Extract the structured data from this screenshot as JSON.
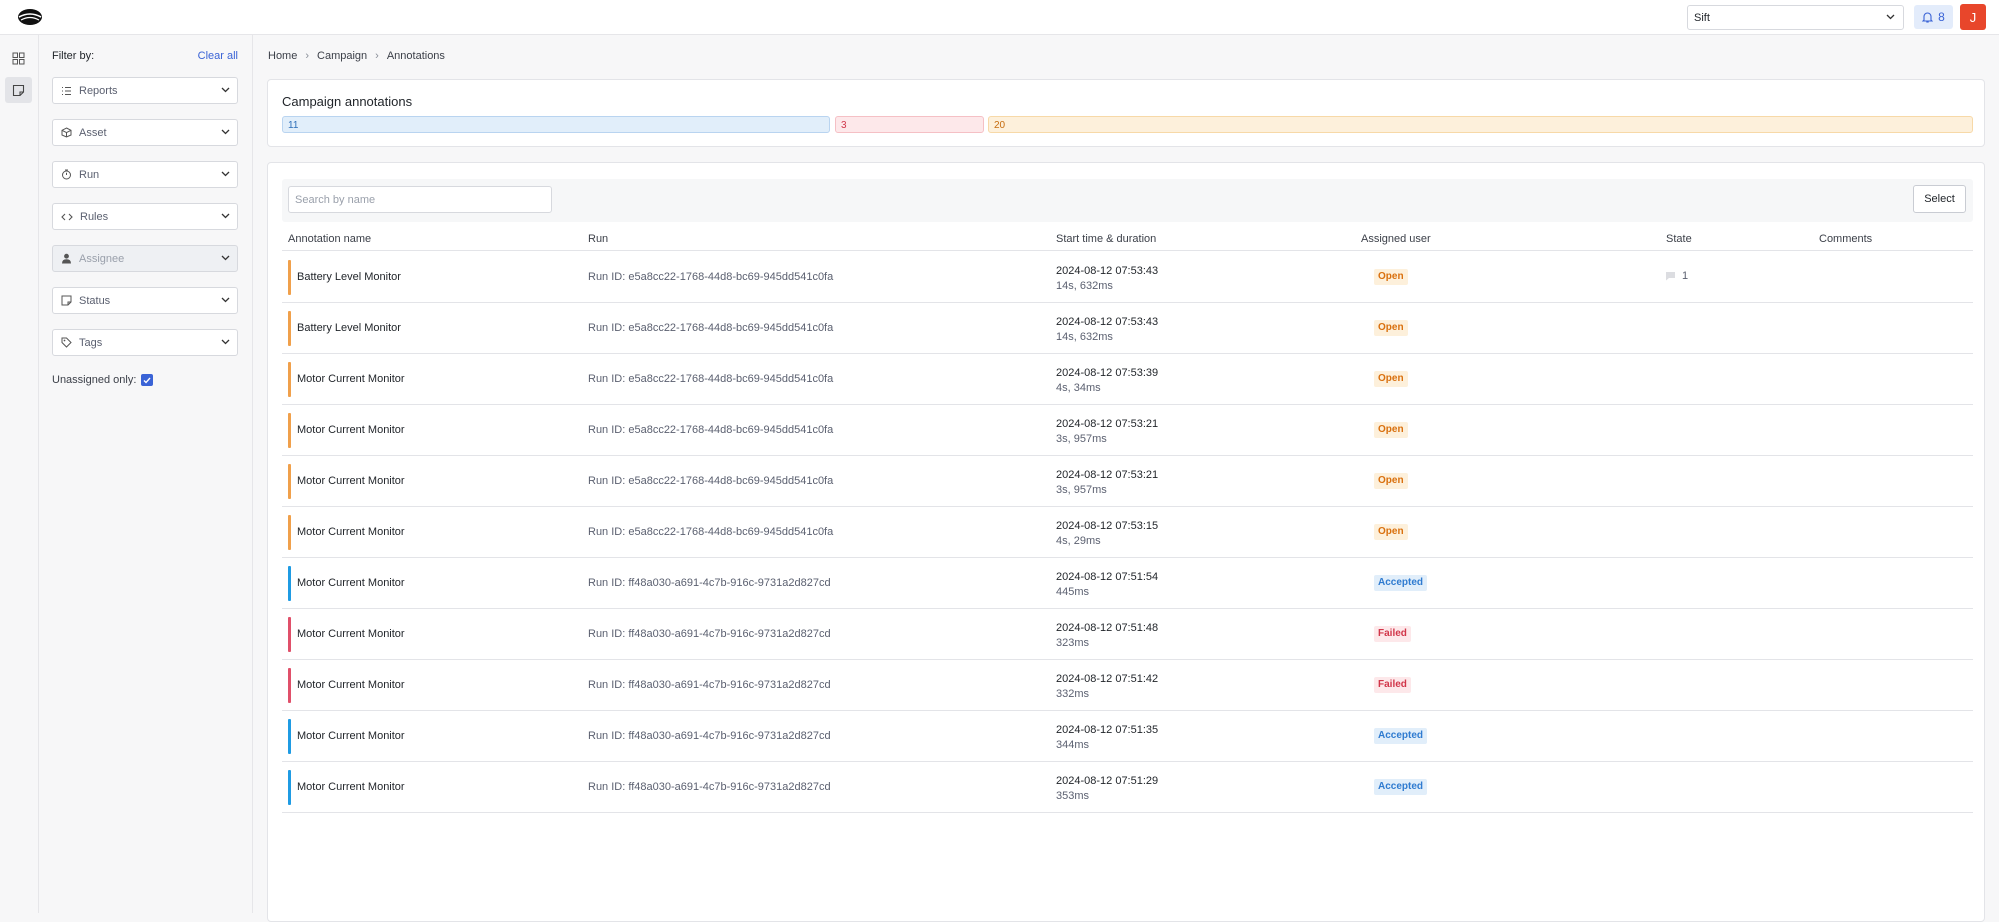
{
  "topbar": {
    "workspace": "Sift",
    "notifications": "8",
    "avatar_initial": "J"
  },
  "rail": [
    {
      "icon": "dashboard-icon"
    },
    {
      "icon": "annotation-icon",
      "active": true
    }
  ],
  "filters": {
    "heading": "Filter by:",
    "clear_all": "Clear all",
    "selects": [
      {
        "label": "Reports",
        "icon": "list-icon"
      },
      {
        "label": "Asset",
        "icon": "box-icon"
      },
      {
        "label": "Run",
        "icon": "timer-icon"
      },
      {
        "label": "Rules",
        "icon": "code-icon"
      },
      {
        "label": "Assignee",
        "icon": "user-icon",
        "disabled": true
      },
      {
        "label": "Status",
        "icon": "note-icon"
      },
      {
        "label": "Tags",
        "icon": "tag-icon"
      }
    ],
    "unassigned_label": "Unassigned only:",
    "unassigned_checked": true
  },
  "breadcrumb": [
    "Home",
    "Campaign",
    "Annotations"
  ],
  "summary": {
    "title": "Campaign annotations",
    "counts": {
      "accepted": "11",
      "failed": "3",
      "open": "20"
    }
  },
  "table": {
    "search_placeholder": "Search by name",
    "select_label": "Select",
    "columns": [
      "Annotation name",
      "Run",
      "Start time & duration",
      "Assigned user",
      "State",
      "Comments"
    ],
    "rows": [
      {
        "name": "Battery Level Monitor",
        "run": "Run ID: e5a8cc22-1768-44d8-bc69-945dd541c0fa",
        "start": "2024-08-12 07:53:43",
        "duration": "14s, 632ms",
        "user": "",
        "state": "Open",
        "comments": "1"
      },
      {
        "name": "Battery Level Monitor",
        "run": "Run ID: e5a8cc22-1768-44d8-bc69-945dd541c0fa",
        "start": "2024-08-12 07:53:43",
        "duration": "14s, 632ms",
        "user": "",
        "state": "Open",
        "comments": ""
      },
      {
        "name": "Motor Current Monitor",
        "run": "Run ID: e5a8cc22-1768-44d8-bc69-945dd541c0fa",
        "start": "2024-08-12 07:53:39",
        "duration": "4s, 34ms",
        "user": "",
        "state": "Open",
        "comments": ""
      },
      {
        "name": "Motor Current Monitor",
        "run": "Run ID: e5a8cc22-1768-44d8-bc69-945dd541c0fa",
        "start": "2024-08-12 07:53:21",
        "duration": "3s, 957ms",
        "user": "",
        "state": "Open",
        "comments": ""
      },
      {
        "name": "Motor Current Monitor",
        "run": "Run ID: e5a8cc22-1768-44d8-bc69-945dd541c0fa",
        "start": "2024-08-12 07:53:21",
        "duration": "3s, 957ms",
        "user": "",
        "state": "Open",
        "comments": ""
      },
      {
        "name": "Motor Current Monitor",
        "run": "Run ID: e5a8cc22-1768-44d8-bc69-945dd541c0fa",
        "start": "2024-08-12 07:53:15",
        "duration": "4s, 29ms",
        "user": "",
        "state": "Open",
        "comments": ""
      },
      {
        "name": "Motor Current Monitor",
        "run": "Run ID: ff48a030-a691-4c7b-916c-9731a2d827cd",
        "start": "2024-08-12 07:51:54",
        "duration": "445ms",
        "user": "",
        "state": "Accepted",
        "comments": ""
      },
      {
        "name": "Motor Current Monitor",
        "run": "Run ID: ff48a030-a691-4c7b-916c-9731a2d827cd",
        "start": "2024-08-12 07:51:48",
        "duration": "323ms",
        "user": "",
        "state": "Failed",
        "comments": ""
      },
      {
        "name": "Motor Current Monitor",
        "run": "Run ID: ff48a030-a691-4c7b-916c-9731a2d827cd",
        "start": "2024-08-12 07:51:42",
        "duration": "332ms",
        "user": "",
        "state": "Failed",
        "comments": ""
      },
      {
        "name": "Motor Current Monitor",
        "run": "Run ID: ff48a030-a691-4c7b-916c-9731a2d827cd",
        "start": "2024-08-12 07:51:35",
        "duration": "344ms",
        "user": "",
        "state": "Accepted",
        "comments": ""
      },
      {
        "name": "Motor Current Monitor",
        "run": "Run ID: ff48a030-a691-4c7b-916c-9731a2d827cd",
        "start": "2024-08-12 07:51:29",
        "duration": "353ms",
        "user": "",
        "state": "Accepted",
        "comments": ""
      }
    ]
  },
  "colors": {
    "open": "#f0a04b",
    "accepted": "#1f9be3",
    "failed": "#e0506a",
    "accent": "#3a63d6"
  }
}
